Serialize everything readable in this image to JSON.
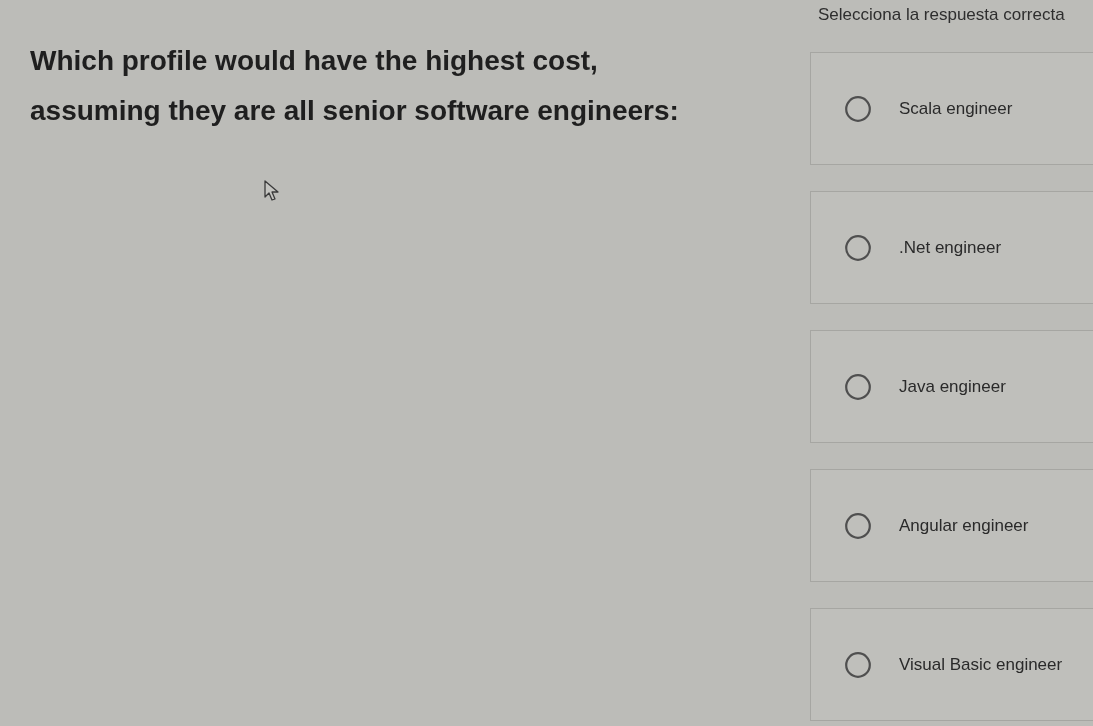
{
  "instruction": "Selecciona la respuesta correcta",
  "question": "Which profile would have the highest cost, assuming they are all senior software engineers:",
  "options": [
    {
      "label": "Scala engineer",
      "selected": false
    },
    {
      "label": ".Net engineer",
      "selected": false
    },
    {
      "label": "Java engineer",
      "selected": false
    },
    {
      "label": "Angular engineer",
      "selected": false
    },
    {
      "label": "Visual Basic engineer",
      "selected": false
    }
  ]
}
